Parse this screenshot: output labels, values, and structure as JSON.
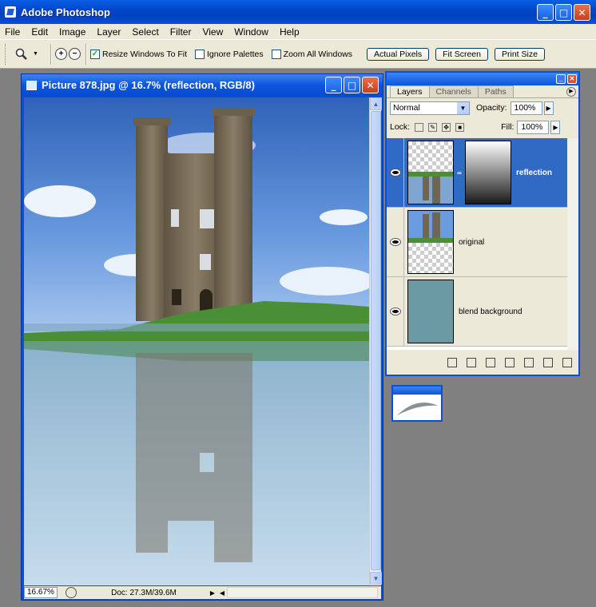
{
  "app": {
    "title": "Adobe Photoshop",
    "min": "_",
    "max": "□",
    "close": "✕"
  },
  "menu": [
    "File",
    "Edit",
    "Image",
    "Layer",
    "Select",
    "Filter",
    "View",
    "Window",
    "Help"
  ],
  "options": {
    "resize_windows": "Resize Windows To Fit",
    "ignore_palettes": "Ignore Palettes",
    "zoom_all": "Zoom All Windows",
    "actual_pixels": "Actual Pixels",
    "fit_screen": "Fit Screen",
    "print_size": "Print Size"
  },
  "document": {
    "title": "Picture 878.jpg @ 16.7% (reflection, RGB/8)",
    "zoom": "16.67%",
    "doc_info": "Doc: 27.3M/39.6M"
  },
  "layers_palette": {
    "tabs": [
      "Layers",
      "Channels",
      "Paths"
    ],
    "blend_mode": "Normal",
    "opacity_label": "Opacity:",
    "opacity": "100%",
    "lock_label": "Lock:",
    "fill_label": "Fill:",
    "fill": "100%",
    "layers": [
      {
        "name": "reflection",
        "selected": true
      },
      {
        "name": "original",
        "selected": false
      },
      {
        "name": "blend background",
        "selected": false
      }
    ]
  },
  "colors": {
    "title_blue": "#0a4fd8",
    "selection": "#316ac5",
    "blend_bg": "#6c9aa2",
    "panel": "#ece9d8"
  }
}
